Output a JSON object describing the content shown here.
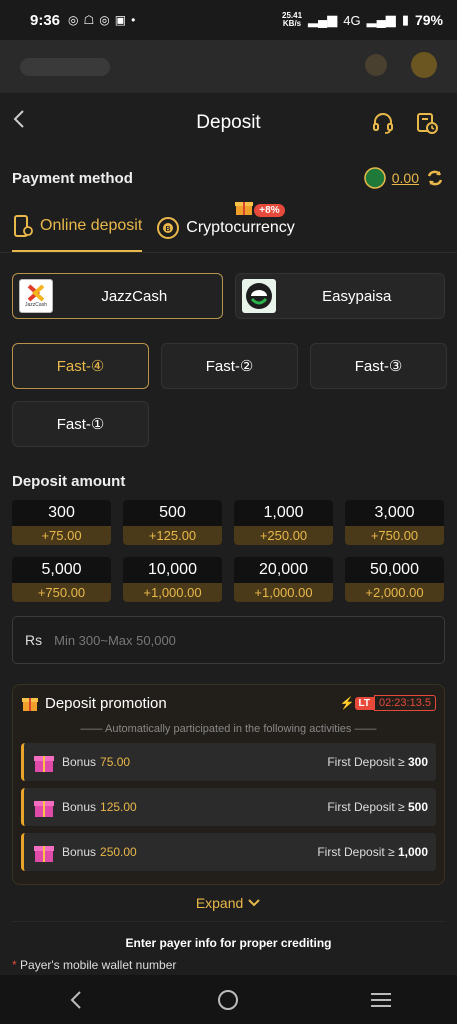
{
  "status": {
    "time": "9:36",
    "net_speed": "25.41",
    "net_unit": "KB/s",
    "network": "4G",
    "battery": "79%"
  },
  "header": {
    "title": "Deposit"
  },
  "payment": {
    "label": "Payment method",
    "balance": "0.00"
  },
  "tabs": [
    {
      "label": "Online deposit"
    },
    {
      "label": "Cryptocurrency"
    }
  ],
  "promo_badge": "+8%",
  "channels": [
    {
      "name": "JazzCash",
      "logo_text": "JazzCash"
    },
    {
      "name": "Easypaisa"
    }
  ],
  "fast_options": [
    "Fast-④",
    "Fast-②",
    "Fast-③",
    "Fast-①"
  ],
  "deposit_amount": {
    "title": "Deposit amount",
    "items": [
      {
        "value": "300",
        "bonus": "+75.00"
      },
      {
        "value": "500",
        "bonus": "+125.00"
      },
      {
        "value": "1,000",
        "bonus": "+250.00"
      },
      {
        "value": "3,000",
        "bonus": "+750.00"
      },
      {
        "value": "5,000",
        "bonus": "+750.00"
      },
      {
        "value": "10,000",
        "bonus": "+1,000.00"
      },
      {
        "value": "20,000",
        "bonus": "+1,000.00"
      },
      {
        "value": "50,000",
        "bonus": "+2,000.00"
      }
    ],
    "currency": "Rs",
    "placeholder": "Min 300~Max 50,000"
  },
  "promotion": {
    "title": "Deposit promotion",
    "lt": "LT",
    "timer": "02:23:13.5",
    "subtitle": "Automatically participated in the following activities",
    "items": [
      {
        "label": "Bonus",
        "bonus": "75.00",
        "cond_label": "First Deposit ≥",
        "cond_value": "300"
      },
      {
        "label": "Bonus",
        "bonus": "125.00",
        "cond_label": "First Deposit ≥",
        "cond_value": "500"
      },
      {
        "label": "Bonus",
        "bonus": "250.00",
        "cond_label": "First Deposit ≥",
        "cond_value": "1,000"
      }
    ],
    "expand": "Expand"
  },
  "payer": {
    "note": "Enter payer info for proper crediting",
    "req": "*",
    "field_label": "Payer's mobile wallet number"
  },
  "colors": {
    "accent": "#e9b84a",
    "alert": "#e74a3b",
    "background": "#1e1e1e"
  }
}
